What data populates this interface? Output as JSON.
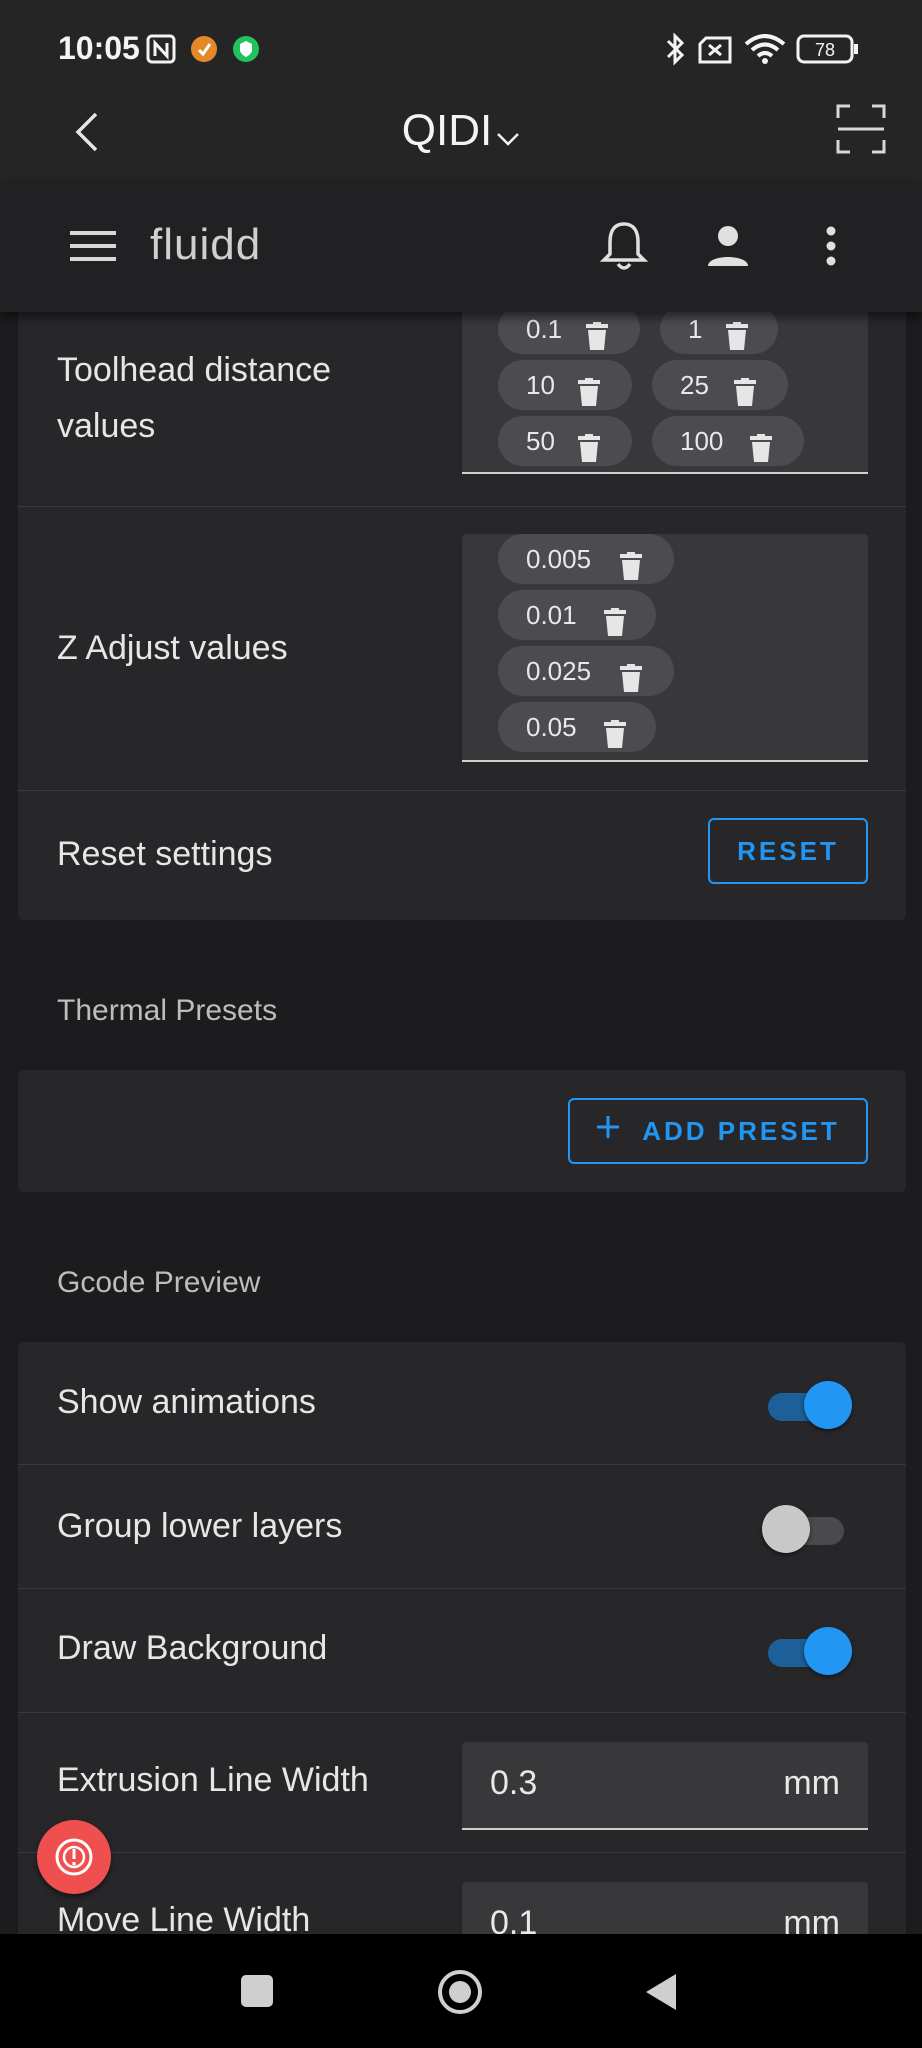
{
  "status": {
    "time": "10:05",
    "battery": "78"
  },
  "appbar": {
    "title": "QIDI"
  },
  "fluidd": {
    "name": "fluidd"
  },
  "toolhead": {
    "label_line1": "Toolhead distance",
    "label_line2": "values",
    "chips": [
      "0.1",
      "1",
      "10",
      "25",
      "50",
      "100"
    ]
  },
  "zadjust": {
    "label": "Z Adjust values",
    "chips": [
      "0.005",
      "0.01",
      "0.025",
      "0.05"
    ]
  },
  "reset": {
    "label": "Reset settings",
    "button": "RESET"
  },
  "thermal": {
    "title": "Thermal Presets",
    "add_button": "ADD PRESET"
  },
  "gcode": {
    "title": "Gcode Preview",
    "show_animations": {
      "label": "Show animations",
      "on": true
    },
    "group_lower_layers": {
      "label": "Group lower layers",
      "on": false
    },
    "draw_background": {
      "label": "Draw Background",
      "on": true
    },
    "extrusion_line_width": {
      "label": "Extrusion Line Width",
      "value": "0.3",
      "unit": "mm"
    },
    "move_line_width": {
      "label": "Move Line Width",
      "value": "0.1",
      "unit": "mm"
    }
  },
  "colors": {
    "accent": "#2196f3",
    "fab": "#ef4f4f",
    "background": "#1c1c1e",
    "card": "#27272a"
  },
  "icons": [
    "nfc-icon",
    "orange-app-icon",
    "green-shield-icon",
    "bluetooth-icon",
    "sim-off-icon",
    "wifi-icon",
    "battery-icon",
    "back-chevron-icon",
    "chevron-down-icon",
    "scan-icon",
    "menu-icon",
    "bell-icon",
    "account-icon",
    "more-vert-icon",
    "trash-icon",
    "plus-icon",
    "alert-icon",
    "nav-square-icon",
    "nav-home-icon",
    "nav-back-icon"
  ]
}
